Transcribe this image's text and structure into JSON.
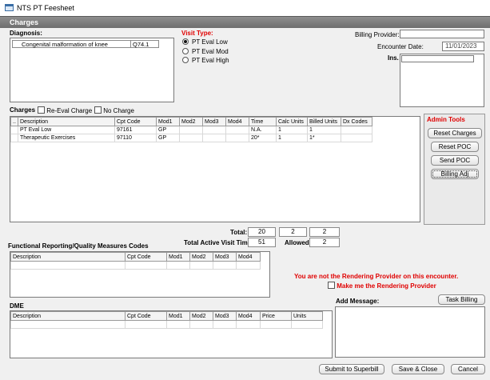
{
  "window": {
    "title": "NTS PT Feesheet"
  },
  "section": {
    "title": "Charges"
  },
  "diagnosis": {
    "label": "Diagnosis:",
    "rows": [
      {
        "description": "Congenital malformation of knee",
        "code": "Q74.1"
      }
    ]
  },
  "visit_type": {
    "label": "Visit Type:",
    "options": [
      "PT Eval Low",
      "PT Eval Mod",
      "PT Eval High"
    ],
    "selected": "PT Eval Low"
  },
  "billing": {
    "provider_label": "Billing Provider:",
    "provider_value": "",
    "encounter_date_label": "Encounter Date:",
    "encounter_date_value": "11/01/2023",
    "ins_label": "Ins."
  },
  "charges": {
    "label": "Charges",
    "re_eval_label": "Re-Eval Charge",
    "no_charge_label": "No Charge",
    "columns": [
      "..",
      "Description",
      "Cpt Code",
      "Mod1",
      "Mod2",
      "Mod3",
      "Mod4",
      "Time",
      "Calc Units",
      "Billed Units",
      "Dx Codes"
    ],
    "rows": [
      {
        "description": "PT Eval Low",
        "cpt": "97161",
        "mod1": "GP",
        "mod2": "",
        "mod3": "",
        "mod4": "",
        "time": "N.A.",
        "calc_units": "1",
        "billed_units": "1",
        "dx": ""
      },
      {
        "description": "Therapeutic Exercises",
        "cpt": "97110",
        "mod1": "GP",
        "mod2": "",
        "mod3": "",
        "mod4": "",
        "time": "20*",
        "calc_units": "1",
        "billed_units": "1*",
        "dx": ""
      }
    ]
  },
  "admin_tools": {
    "title": "Admin Tools",
    "buttons": [
      "Reset Charges",
      "Reset POC",
      "Send POC",
      "Billing Adj"
    ]
  },
  "totals": {
    "total_label": "Total:",
    "time_total": "20",
    "calc_total": "2",
    "billed_total": "2",
    "active_visit_label": "Total Active Visit Time:",
    "active_visit_value": "51",
    "allowed_label": "Allowed:",
    "allowed_value": "2"
  },
  "functional": {
    "label": "Functional Reporting/Quality Measures Codes",
    "columns": [
      "Description",
      "Cpt Code",
      "Mod1",
      "Mod2",
      "Mod3",
      "Mod4"
    ]
  },
  "rendering": {
    "warning": "You are not the Rendering Provider on this encounter.",
    "checkbox_label": "Make me the Rendering Provider"
  },
  "dme": {
    "label": "DME",
    "columns": [
      "Description",
      "Cpt Code",
      "Mod1",
      "Mod2",
      "Mod3",
      "Mod4",
      "Price",
      "Units"
    ]
  },
  "message": {
    "label": "Add Message:",
    "task_billing": "Task Billing",
    "value": ""
  },
  "footer": {
    "submit": "Submit to Superbill",
    "save_close": "Save & Close",
    "cancel": "Cancel"
  },
  "colors": {
    "warning_red": "#e00000",
    "header_bar": "#7a7a7a"
  }
}
